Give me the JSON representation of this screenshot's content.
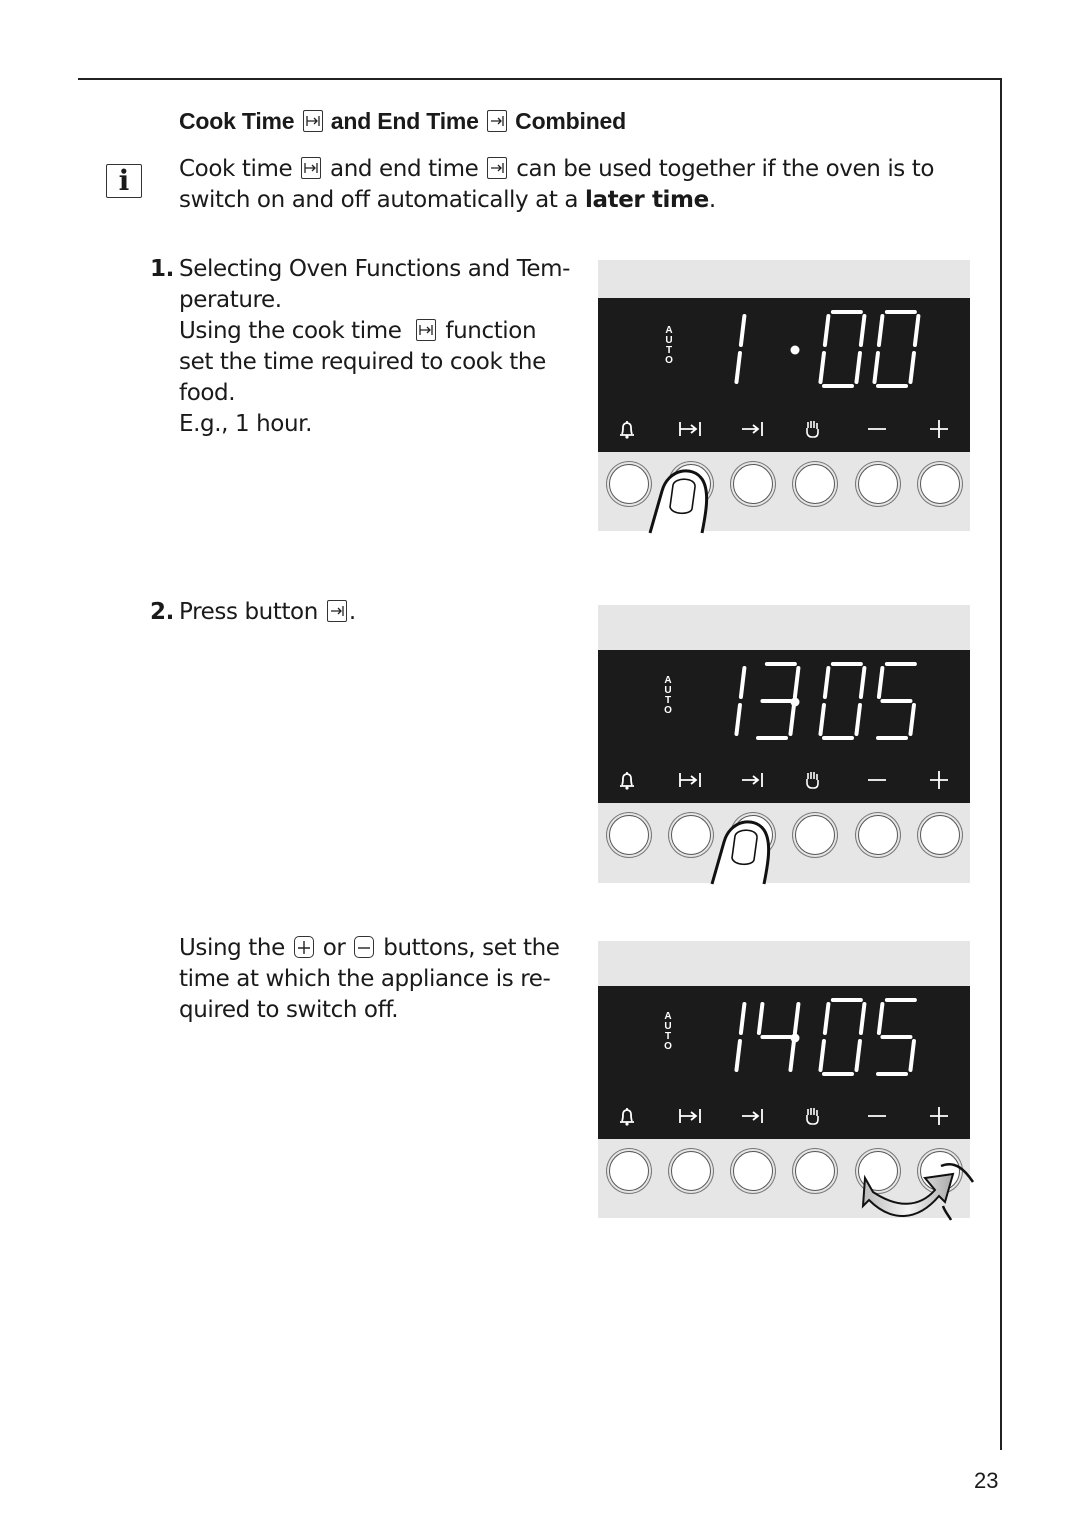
{
  "page": {
    "heading": {
      "part1": "Cook Time",
      "part2": "and End Time",
      "part3": "Combined"
    },
    "info_icon": "i",
    "intro": {
      "t1": "Cook time",
      "t2": "and end time",
      "t3": "can be used together if the oven is to switch on and off automatically at a",
      "bold": "later time",
      "t4": "."
    },
    "steps": [
      {
        "number": "1.",
        "line1": "Selecting Oven Functions and Tem-",
        "line2": "perature.",
        "line3a": "Using the cook time",
        "line3b": "function",
        "line4": "set the time required to cook the",
        "line5": "food.",
        "line6": "E.g., 1 hour."
      },
      {
        "number": "2.",
        "text": "Press button",
        "after": "."
      },
      {
        "t1": "Using the",
        "t2": "or",
        "t3": "buttons, set the",
        "line2": "time at which the appliance is re-",
        "line3": "quired to switch off."
      }
    ],
    "page_number": "23"
  },
  "panels": [
    {
      "auto_label": [
        "A",
        "U",
        "T",
        "O"
      ],
      "display": "1·00",
      "digits": [
        "1",
        "",
        "0",
        "0"
      ],
      "pressed_button": "cook-time",
      "gesture": "finger-press"
    },
    {
      "auto_label": [
        "A",
        "U",
        "T",
        "O"
      ],
      "display": "13·05",
      "digits": [
        "1",
        "3",
        "0",
        "5"
      ],
      "pressed_button": "end-time",
      "gesture": "finger-press"
    },
    {
      "auto_label": [
        "A",
        "U",
        "T",
        "O"
      ],
      "display": "14·05",
      "digits": [
        "1",
        "4",
        "0",
        "5"
      ],
      "pressed_button": "minus/plus",
      "gesture": "rotate-arrow"
    }
  ],
  "button_icons": [
    "bell-icon",
    "cook-time-icon",
    "end-time-icon",
    "manual-hand-icon",
    "minus-icon",
    "plus-icon"
  ],
  "colors": {
    "panel_bg": "#e6e6e6",
    "display_bg": "#1b1b1b",
    "segment": "#ffffff",
    "text": "#1a1a1a"
  }
}
